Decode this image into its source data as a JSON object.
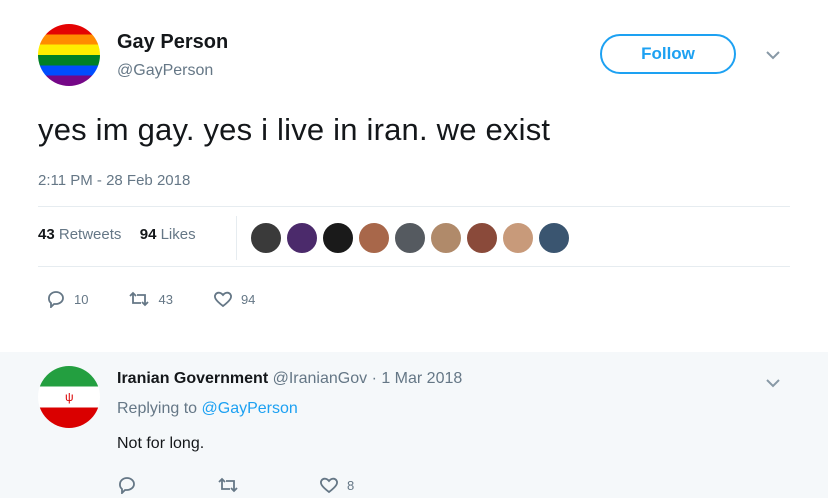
{
  "tweet": {
    "display_name": "Gay Person",
    "handle": "@GayPerson",
    "follow_label": "Follow",
    "text": "yes im gay. yes i live in iran. we exist",
    "timestamp": "2:11 PM - 28 Feb 2018",
    "retweet_count": "43",
    "retweet_label": "Retweets",
    "like_count": "94",
    "like_label": "Likes",
    "actions": {
      "replies": "10",
      "retweets": "43",
      "likes": "94"
    },
    "avatar_icon": "rainbow-flag-avatar",
    "liker_faces": [
      "#3a3a3a",
      "#4b2a6b",
      "#1a1a1a",
      "#a8674a",
      "#555a60",
      "#b08a6a",
      "#8a4a3a",
      "#c89a7a",
      "#3a5570"
    ]
  },
  "reply": {
    "display_name": "Iranian Government",
    "meta": "@IranianGov · 1 Mar 2018",
    "replying_prefix": "Replying to ",
    "replying_to": "@GayPerson",
    "text": "Not for long.",
    "actions": {
      "likes": "8"
    },
    "avatar_icon": "iran-flag-avatar"
  },
  "colors": {
    "accent": "#1da1f2",
    "secondary_text": "#657786",
    "reply_background": "#f5f8fa"
  }
}
